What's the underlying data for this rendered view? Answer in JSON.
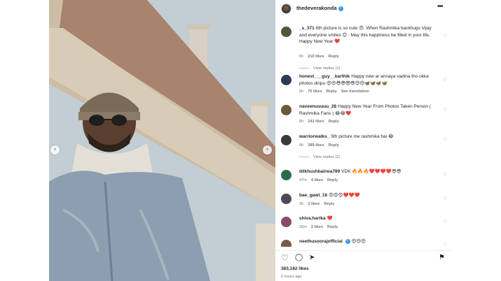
{
  "post": {
    "username": "thedeverakonda",
    "likes": "383,182 likes",
    "time": "6 hours ago",
    "more_icon": "•••"
  },
  "nav": {
    "prev": "‹",
    "next": "›"
  },
  "actions": {
    "like_icon": "♡",
    "comment_icon": "◯",
    "share_icon": "➤",
    "save_icon": "⚑"
  },
  "comments": [
    {
      "user": "_s_371",
      "text": "6th picture is so cute 😍. When Rashmika backhugs Vijay and everyone smiles 😊 . May this happiness be filled in your life, Happy New Year ❤️",
      "time": "6h",
      "likes": "210 likes",
      "reply": "Reply",
      "view_replies": "View replies (1)"
    },
    {
      "user": "honest___guy__karthik",
      "text": "Happy new ar annaya vadina tho okka photos dinpu 😍😍😎😎😎😎😍😍🦋🦋🦋🦋",
      "time": "6h",
      "likes": "75 likes",
      "reply": "Reply",
      "translation": "See translation"
    },
    {
      "user": "naveenuuuuu_28",
      "text": "Happy New Year From Photos Taken Person ( Rashmika Fans ) 😂😂❤️",
      "time": "6h",
      "likes": "241 likes",
      "reply": "Reply"
    },
    {
      "user": "warriorwalks_",
      "text": "5th picture me rashmika hai 😂",
      "time": "6h",
      "likes": "389 likes",
      "reply": "Reply",
      "view_replies": "View replies (2)"
    },
    {
      "user": "dilkhushbairwa789",
      "text": "VDK 🔥🔥🔥❤️❤️❤️❤️😎😎",
      "time": "47m",
      "likes": "4 likes",
      "reply": "Reply"
    },
    {
      "user": "bae_gawl_16",
      "text": "😍😍😍❤️❤️❤️",
      "time": "3h",
      "likes": "2 likes",
      "reply": "Reply"
    },
    {
      "user": "shiva.harika",
      "text": "❤️",
      "time": "35m",
      "likes": "2 likes",
      "reply": "Reply"
    },
    {
      "user": "neethusoorajofficial",
      "text": "😍😍😍",
      "time": "",
      "likes": "",
      "reply": ""
    }
  ],
  "colors": {
    "verified": "#3897f0",
    "muted": "#737373",
    "text": "#262626"
  }
}
